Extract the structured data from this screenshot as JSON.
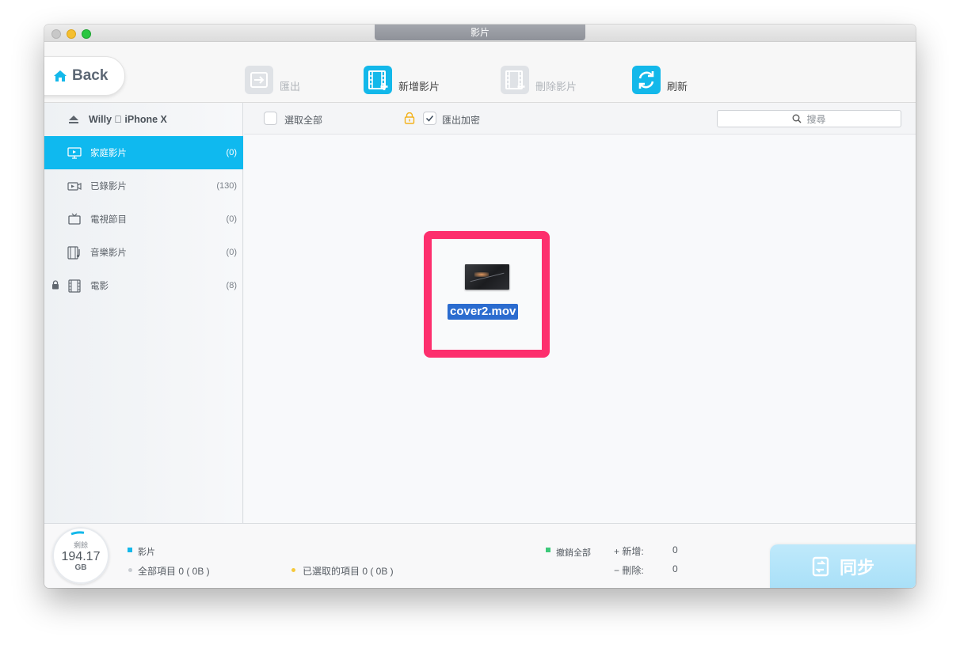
{
  "window": {
    "title": "影片"
  },
  "toolbar": {
    "back_label": "Back",
    "export_label": "匯出",
    "add_label": "新增影片",
    "delete_label": "刪除影片",
    "refresh_label": "刷新"
  },
  "sidebar": {
    "device_name": "Willy  iPhone X",
    "items": [
      {
        "label": "家庭影片",
        "count": "(0)"
      },
      {
        "label": "已錄影片",
        "count": "(130)"
      },
      {
        "label": "電視節目",
        "count": "(0)"
      },
      {
        "label": "音樂影片",
        "count": "(0)"
      },
      {
        "label": "電影",
        "count": "(8)"
      }
    ]
  },
  "main": {
    "select_all_label": "選取全部",
    "export_encrypt_label": "匯出加密",
    "search_placeholder": "搜尋",
    "file_name": "cover2.mov"
  },
  "footer": {
    "storage_label": "剩餘",
    "storage_value": "194.17",
    "storage_unit": "GB",
    "category": "影片",
    "all_items": "全部項目 0 ( 0B )",
    "selected_items": "已選取的項目 0 ( 0B )",
    "undo_all": "撤銷全部",
    "add_label": "+ 新增:",
    "add_value": "0",
    "delete_label": "− 刪除:",
    "delete_value": "0",
    "sync_label": "同步"
  },
  "colors": {
    "accent": "#13b8ea",
    "highlight_frame": "#fd2f6d",
    "selection": "#2b6ccf"
  }
}
